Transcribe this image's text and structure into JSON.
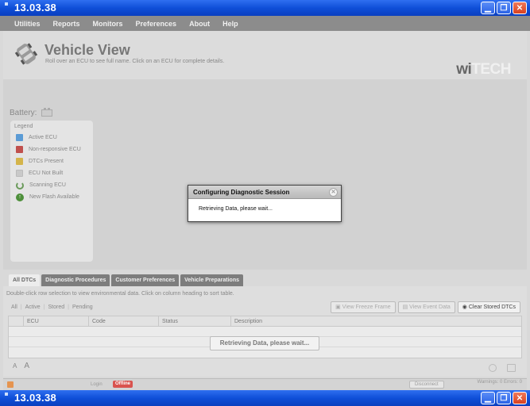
{
  "window": {
    "title": "13.03.38"
  },
  "menu": [
    "Utilities",
    "Reports",
    "Monitors",
    "Preferences",
    "About",
    "Help"
  ],
  "header": {
    "title": "Vehicle View",
    "subtitle": "Roll over an ECU to see full name. Click on an ECU for complete details.",
    "logo_dark": "wi",
    "logo_light": "TECH"
  },
  "battery": {
    "label": "Battery:"
  },
  "legend": {
    "title": "Legend",
    "items": [
      {
        "label": "Active ECU",
        "color": "#5b9bd5"
      },
      {
        "label": "Non-responsive ECU",
        "color": "#c0504d"
      },
      {
        "label": "DTCs Present",
        "color": "#d4b44a"
      },
      {
        "label": "ECU Not Built",
        "color": "#c9c9c9"
      },
      {
        "label": "Scanning ECU",
        "icon": "scanning-icon"
      },
      {
        "label": "New Flash Available",
        "icon": "flash-icon"
      }
    ]
  },
  "dialog": {
    "title": "Configuring Diagnostic Session",
    "message": "Retrieving Data, please wait..."
  },
  "tabs": [
    "All DTCs",
    "Diagnostic Procedures",
    "Customer Preferences",
    "Vehicle Preparations"
  ],
  "panel": {
    "hint": "Double-click row selection to view environmental data.  Click on column heading to sort table.",
    "filters": [
      "All",
      "Active",
      "Stored",
      "Pending"
    ],
    "buttons": [
      "View Freeze Frame",
      "View Event Data",
      "Clear Stored DTCs"
    ],
    "columns": [
      "",
      "ECU",
      "Code",
      "Status",
      "Description"
    ],
    "loading": "Retrieving Data, please wait...",
    "font_small": "A",
    "font_large": "A"
  },
  "status": {
    "login": "Login",
    "offline": "Offline",
    "disconnect": "Disconnect",
    "warnings": "Warnings: 0  Errors: 0"
  }
}
